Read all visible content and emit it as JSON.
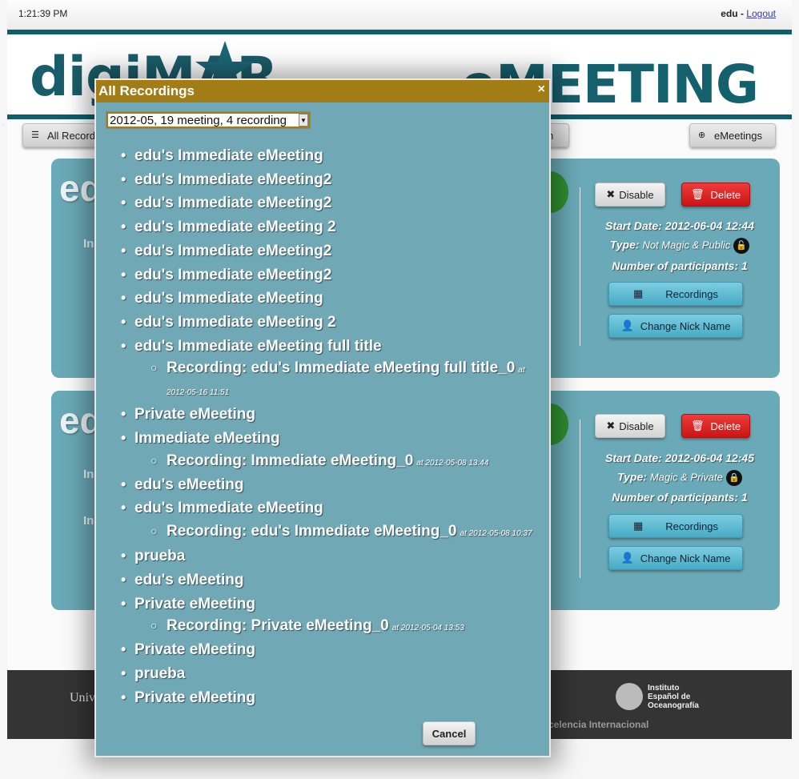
{
  "topbar": {
    "time": "1:21:39 PM",
    "user": "edu",
    "separator": " - ",
    "logout": "Logout"
  },
  "header": {
    "logo_left": "digiMAR",
    "logo_right": "eMEETING"
  },
  "nav": {
    "all_recordings": "All Recordings",
    "hidden_middle": "n",
    "emeetings": "eMeetings"
  },
  "cards": [
    {
      "title": "edu",
      "disable": "Disable",
      "delete": "Delete",
      "start_date_label": "Start Date:",
      "start_date": "2012-06-04 12:44",
      "type_label": "Type:",
      "type_value": "Not Magic & Public",
      "participants_label": "Number of participants:",
      "participants": "1",
      "recordings": "Recordings",
      "change_nick": "Change Nick Name",
      "side_label_1": "In",
      "side_label_2": ""
    },
    {
      "title": "edu",
      "disable": "Disable",
      "delete": "Delete",
      "start_date_label": "Start Date:",
      "start_date": "2012-06-04 12:45",
      "type_label": "Type:",
      "type_value": "Magic & Private",
      "participants_label": "Number of participants:",
      "participants": "1",
      "recordings": "Recordings",
      "change_nick": "Change Nick Name",
      "side_label_1": "In",
      "side_label_2": "In"
    }
  ],
  "footer": {
    "uni": "Univ",
    "ieo_line1": "Instituto",
    "ieo_line2": "Español de",
    "ieo_line3": "Oceanografía",
    "excelencia": "celencia Internacional"
  },
  "modal": {
    "title": "All Recordings",
    "close": "×",
    "select_value": "2012-05, 19 meeting, 4 recording",
    "items": [
      {
        "name": "edu's Immediate eMeeting"
      },
      {
        "name": "edu's Immediate eMeeting2"
      },
      {
        "name": "edu's Immediate eMeeting2"
      },
      {
        "name": "edu's Immediate eMeeting 2"
      },
      {
        "name": "edu's Immediate eMeeting2"
      },
      {
        "name": "edu's Immediate eMeeting2"
      },
      {
        "name": "edu's Immediate eMeeting"
      },
      {
        "name": "edu's Immediate eMeeting 2"
      },
      {
        "name": "edu's Immediate eMeeting full title"
      },
      {
        "recording": "Recording: edu's Immediate eMeeting full title_0",
        "at": "at 2012-05-16 11:51"
      },
      {
        "name": "Private eMeeting"
      },
      {
        "name": "Immediate eMeeting"
      },
      {
        "recording": "Recording: Immediate eMeeting_0",
        "at": "at 2012-05-08 13:44"
      },
      {
        "name": "edu's eMeeting"
      },
      {
        "name": "edu's Immediate eMeeting"
      },
      {
        "recording": "Recording: edu's Immediate eMeeting_0",
        "at": "at 2012-05-08 10:37"
      },
      {
        "name": "prueba"
      },
      {
        "name": "edu's eMeeting"
      },
      {
        "name": "Private eMeeting"
      },
      {
        "recording": "Recording: Private eMeeting_0",
        "at": "at 2012-05-04 13:53"
      },
      {
        "name": "Private eMeeting"
      },
      {
        "name": "prueba"
      },
      {
        "name": "Private eMeeting"
      }
    ],
    "cancel": "Cancel"
  }
}
